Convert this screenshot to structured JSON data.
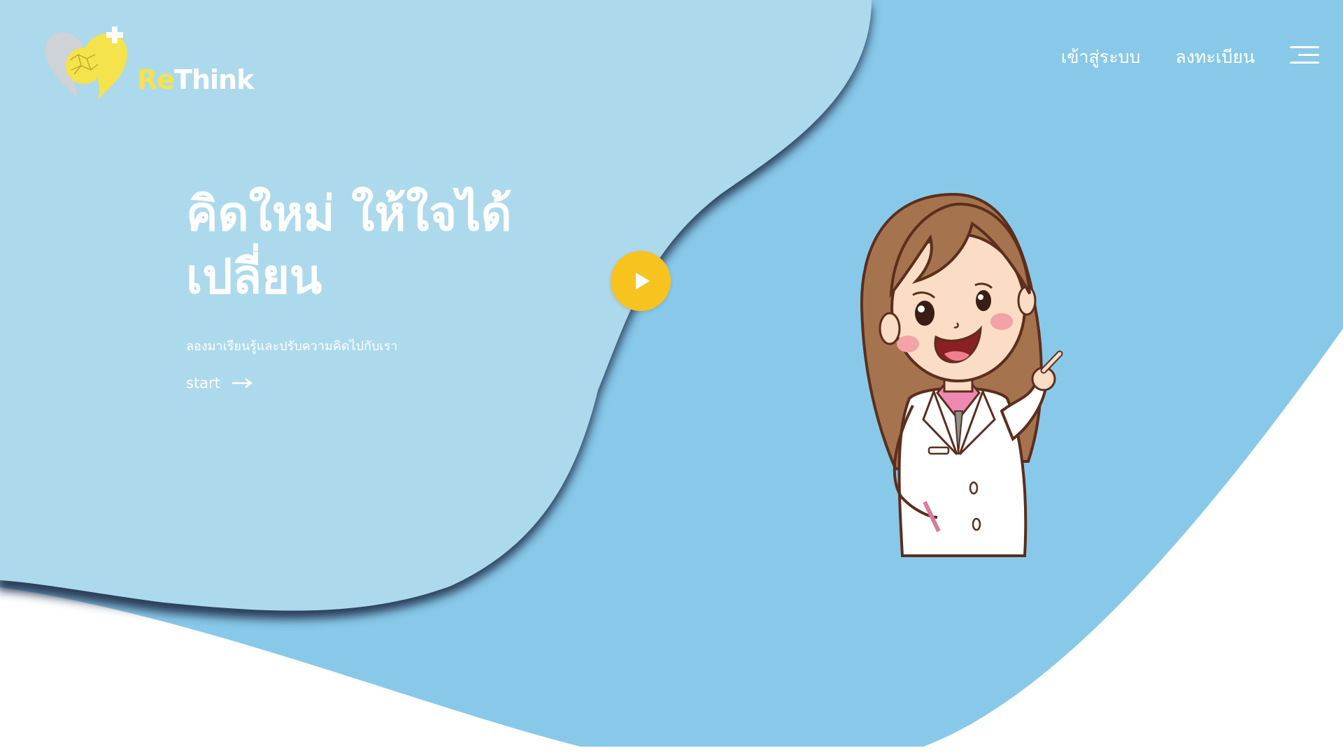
{
  "brand": {
    "name_prefix": "Re",
    "name_suffix": "Think",
    "logo_icon": "heart-brain-plus-logo"
  },
  "nav": {
    "login": "เข้าสู่ระบบ",
    "register": "ลงทะเบียน",
    "menu_icon": "hamburger-menu-icon"
  },
  "hero": {
    "title_line1": "คิดใหม่ ให้ใจได้",
    "title_line2": "เปลี่ยน",
    "subtitle": "ลองมาเรียนรู้และปรับความคิดไปกับเรา",
    "cta_label": "start",
    "cta_icon": "arrow-right-icon",
    "play_icon": "play-icon",
    "illustration": "doctor-girl-pointing"
  },
  "colors": {
    "light_blue": "#add9ed",
    "mid_blue": "#88c9ea",
    "accent_yellow": "#f6c31f",
    "logo_yellow": "#f4e34a",
    "shadow_navy": "#2a3e59",
    "text": "#ffffff"
  }
}
